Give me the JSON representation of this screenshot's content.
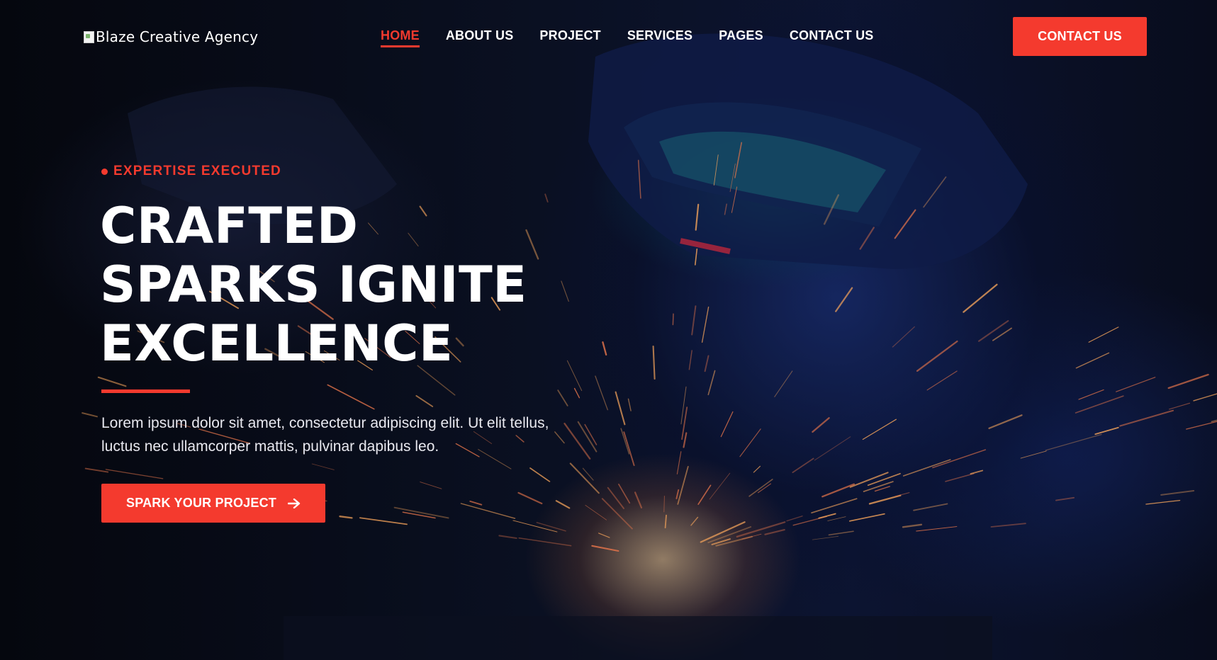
{
  "header": {
    "logo_alt": "Blaze Creative Agency",
    "nav": [
      {
        "label": "HOME",
        "active": true
      },
      {
        "label": "ABOUT US",
        "active": false
      },
      {
        "label": "PROJECT",
        "active": false
      },
      {
        "label": "SERVICES",
        "active": false
      },
      {
        "label": "PAGES",
        "active": false
      },
      {
        "label": "CONTACT US",
        "active": false
      }
    ],
    "cta_label": "CONTACT US"
  },
  "hero": {
    "eyebrow": "EXPERTISE EXECUTED",
    "headline": [
      "CRAFTED",
      "SPARKS IGNITE",
      "EXCELLENCE"
    ],
    "lead": "Lorem ipsum dolor sit amet, consectetur adipiscing elit. Ut elit tellus, luctus nec ullamcorper mattis, pulvinar dapibus leo.",
    "cta_label": "SPARK YOUR PROJECT",
    "cta_icon": "arrow-right-icon"
  },
  "colors": {
    "accent": "#f43a2e",
    "text": "#ffffff",
    "background": "#06080f"
  }
}
